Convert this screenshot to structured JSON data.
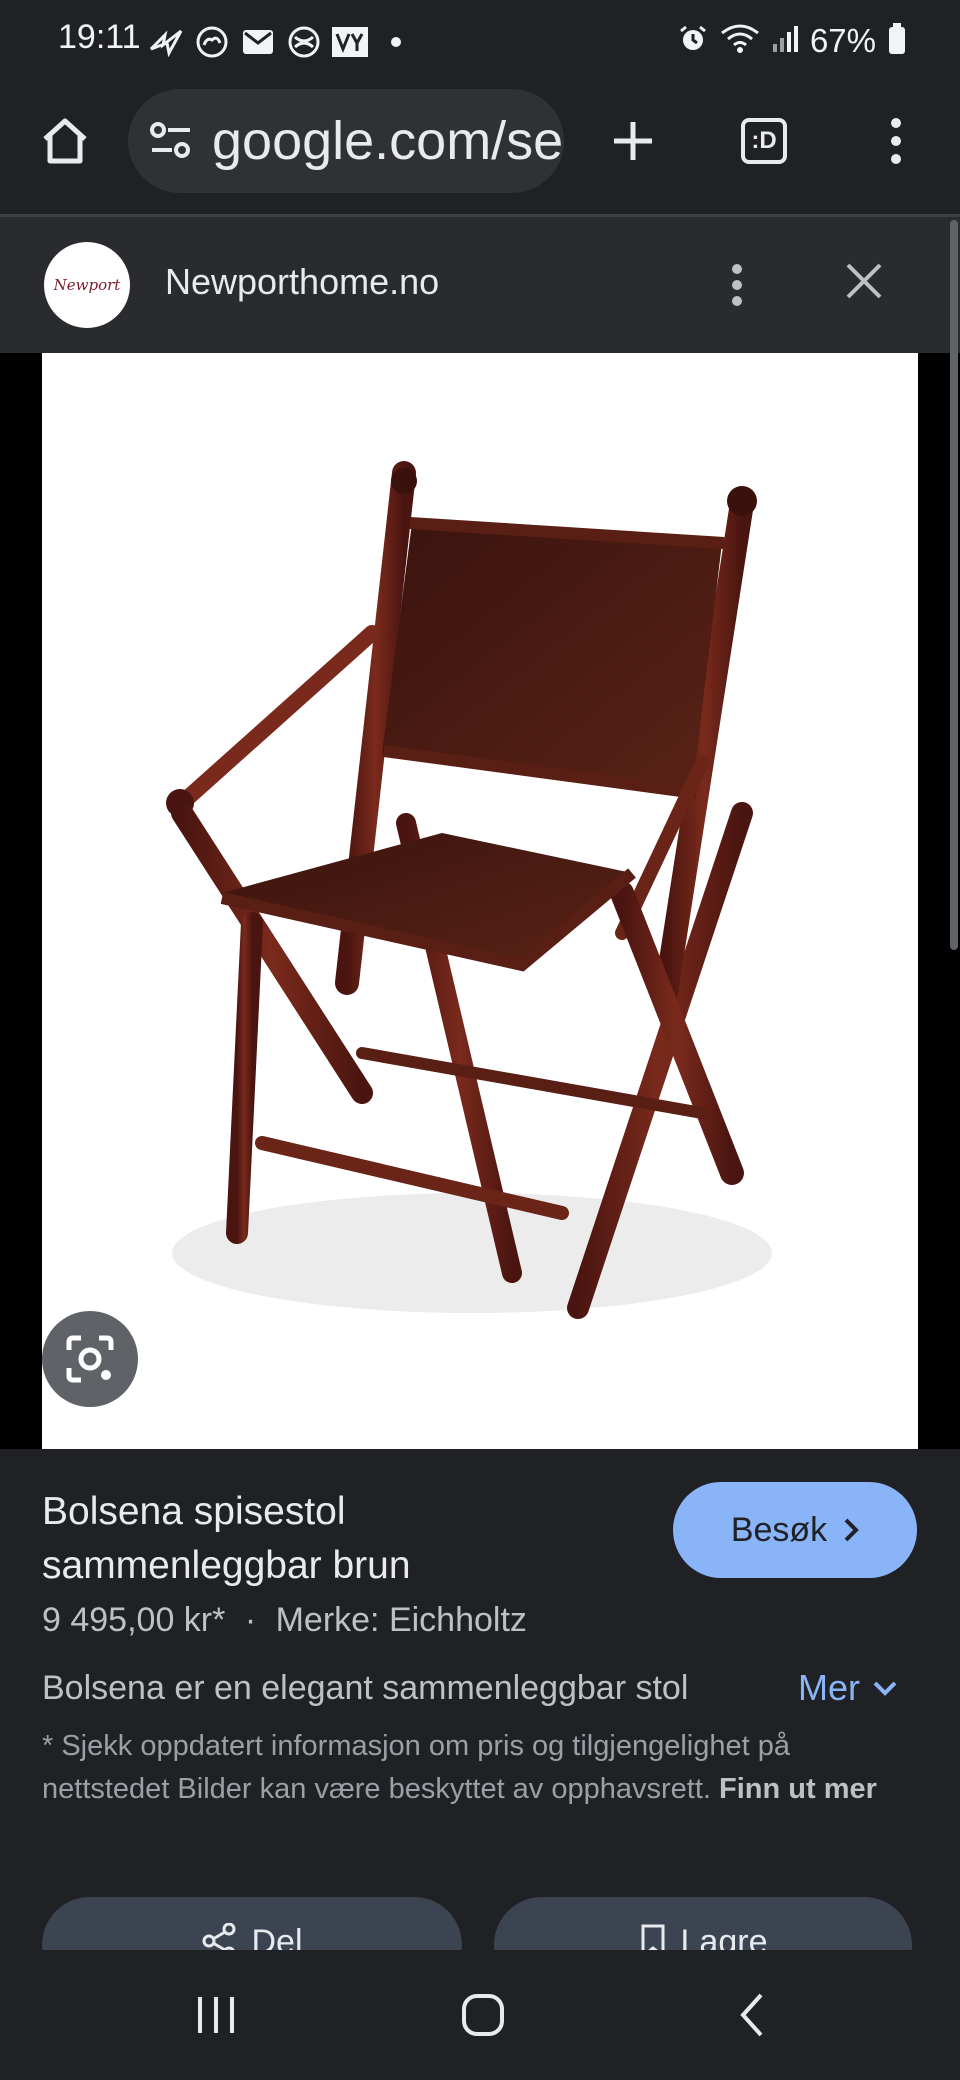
{
  "status_bar": {
    "time": "19:11",
    "battery": "67%",
    "left_icons": [
      "wing-icon",
      "cloud-icon",
      "mail-icon",
      "app-icon",
      "vy-icon",
      "dot-icon"
    ],
    "right_icons": [
      "alarm-icon",
      "wifi-icon",
      "signal-icon",
      "battery-icon"
    ]
  },
  "browser": {
    "url": "google.com/search"
  },
  "site": {
    "name": "Newporthome.no",
    "logo_text": "Newport"
  },
  "product": {
    "title": "Bolsena spisestol sammenleggbar brun",
    "price": "9 495,00 kr*",
    "separator": "·",
    "brand": "Merke: Eichholtz",
    "description": "Bolsena er en elegant sammenleggbar stol",
    "more_label": "Mer",
    "visit_label": "Besøk",
    "disclaimer": "* Sjekk oppdatert informasjon om pris og tilgjengelighet på nettstedet Bilder kan være beskyttet av opphavsrett.",
    "disclaimer_link": "Finn ut mer",
    "share_label": "Del",
    "save_label": "Lagre"
  },
  "colors": {
    "background": "#202124",
    "header": "#2a2b2e",
    "accent": "#8ab4f8",
    "chair_wood": "#6e2418"
  }
}
